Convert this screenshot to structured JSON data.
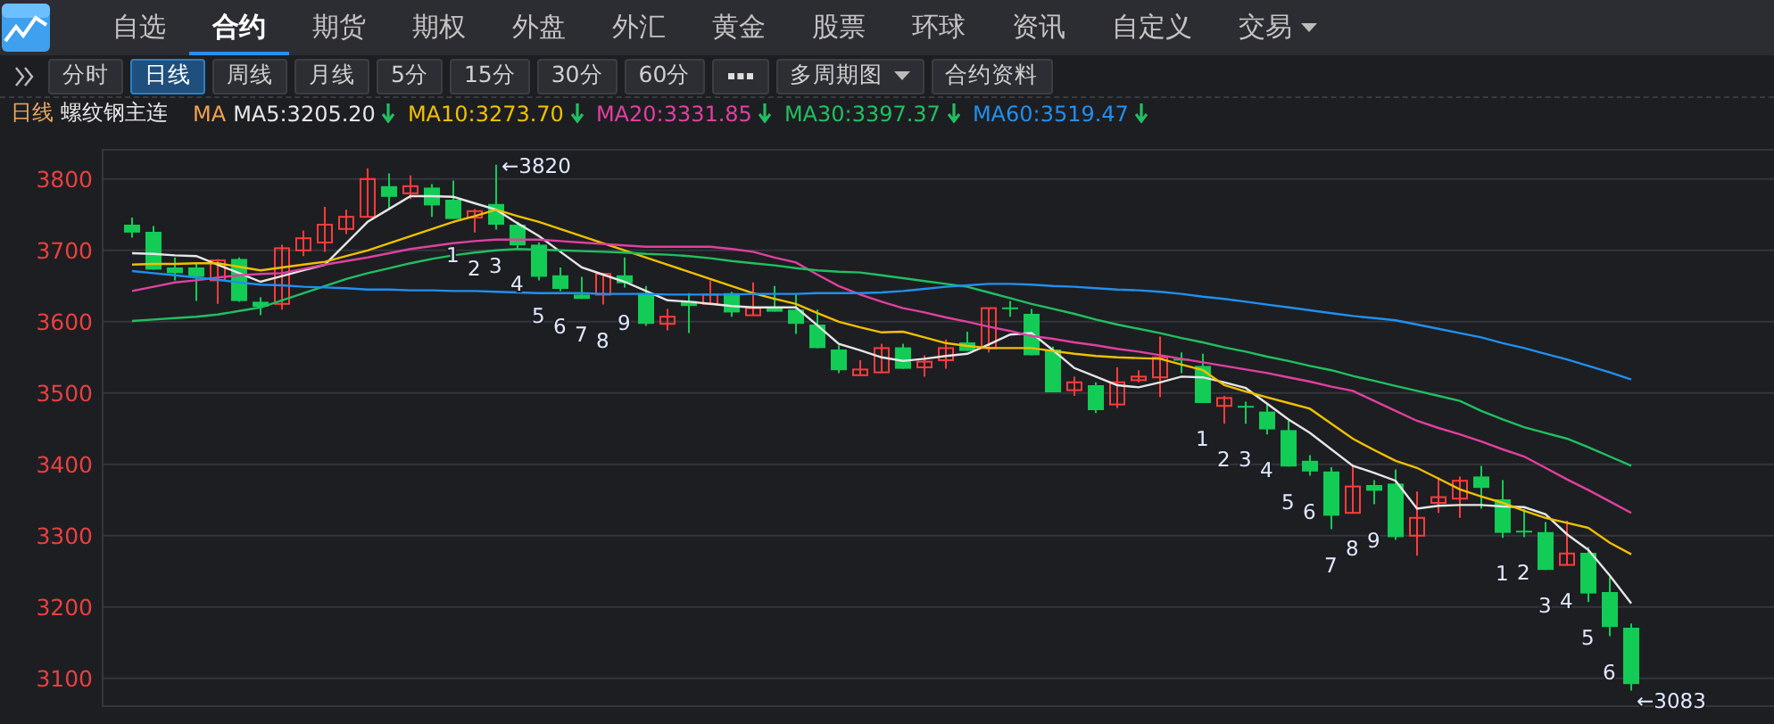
{
  "nav": {
    "tabs": [
      {
        "label": "自选",
        "selected": false,
        "dropdown": false
      },
      {
        "label": "合约",
        "selected": true,
        "dropdown": false
      },
      {
        "label": "期货",
        "selected": false,
        "dropdown": false
      },
      {
        "label": "期权",
        "selected": false,
        "dropdown": false
      },
      {
        "label": "外盘",
        "selected": false,
        "dropdown": false
      },
      {
        "label": "外汇",
        "selected": false,
        "dropdown": false
      },
      {
        "label": "黄金",
        "selected": false,
        "dropdown": false
      },
      {
        "label": "股票",
        "selected": false,
        "dropdown": false
      },
      {
        "label": "环球",
        "selected": false,
        "dropdown": false
      },
      {
        "label": "资讯",
        "selected": false,
        "dropdown": false
      },
      {
        "label": "自定义",
        "selected": false,
        "dropdown": false
      },
      {
        "label": "交易",
        "selected": false,
        "dropdown": true
      }
    ]
  },
  "toolbar": {
    "buttons": [
      {
        "kind": "text",
        "label": "分时",
        "selected": false
      },
      {
        "kind": "text",
        "label": "日线",
        "selected": true
      },
      {
        "kind": "text",
        "label": "周线",
        "selected": false
      },
      {
        "kind": "text",
        "label": "月线",
        "selected": false
      },
      {
        "kind": "text",
        "label": "5分",
        "selected": false
      },
      {
        "kind": "text",
        "label": "15分",
        "selected": false
      },
      {
        "kind": "text",
        "label": "30分",
        "selected": false
      },
      {
        "kind": "text",
        "label": "60分",
        "selected": false
      },
      {
        "kind": "more",
        "selected": false
      },
      {
        "kind": "dropdown",
        "label": "多周期图",
        "selected": false
      },
      {
        "kind": "text",
        "label": "合约资料",
        "selected": false
      }
    ]
  },
  "indicator_bar": {
    "period": "日线",
    "symbol": "螺纹钢主连",
    "label": "MA",
    "items": [
      {
        "text": "MA5:3205.20",
        "color": "#e6e6e6",
        "falling": true
      },
      {
        "text": "MA10:3273.70",
        "color": "#f0c000",
        "falling": true
      },
      {
        "text": "MA20:3331.85",
        "color": "#e040a0",
        "falling": true
      },
      {
        "text": "MA30:3397.37",
        "color": "#20c060",
        "falling": true
      },
      {
        "text": "MA60:3519.47",
        "color": "#2090f0",
        "falling": true
      }
    ]
  },
  "chart": {
    "chart_data": {
      "type": "candlestick",
      "grid": true,
      "ylim": [
        3061,
        3841
      ],
      "yticks": [
        3800,
        3700,
        3600,
        3500,
        3400,
        3300,
        3200,
        3100
      ],
      "ohlc": [
        [
          3736,
          3746,
          3718,
          3725
        ],
        [
          3726,
          3734,
          3673,
          3673
        ],
        [
          3676,
          3690,
          3658,
          3668
        ],
        [
          3676,
          3682,
          3629,
          3663
        ],
        [
          3658,
          3688,
          3625,
          3686
        ],
        [
          3688,
          3690,
          3628,
          3629
        ],
        [
          3628,
          3634,
          3609,
          3621
        ],
        [
          3625,
          3708,
          3617,
          3703
        ],
        [
          3700,
          3728,
          3692,
          3717
        ],
        [
          3711,
          3761,
          3698,
          3736
        ],
        [
          3730,
          3757,
          3723,
          3747
        ],
        [
          3747,
          3815,
          3747,
          3800
        ],
        [
          3790,
          3808,
          3757,
          3775
        ],
        [
          3780,
          3805,
          3772,
          3790
        ],
        [
          3788,
          3793,
          3747,
          3763
        ],
        [
          3771,
          3798,
          3744,
          3744
        ],
        [
          3746,
          3758,
          3725,
          3755
        ],
        [
          3765,
          3820,
          3729,
          3736
        ],
        [
          3736,
          3740,
          3703,
          3707
        ],
        [
          3708,
          3711,
          3658,
          3663
        ],
        [
          3665,
          3676,
          3643,
          3646
        ],
        [
          3638,
          3663,
          3632,
          3632
        ],
        [
          3638,
          3667,
          3624,
          3667
        ],
        [
          3665,
          3690,
          3648,
          3654
        ],
        [
          3640,
          3650,
          3594,
          3597
        ],
        [
          3597,
          3618,
          3588,
          3607
        ],
        [
          3629,
          3640,
          3584,
          3622
        ],
        [
          3625,
          3658,
          3625,
          3638
        ],
        [
          3640,
          3642,
          3607,
          3613
        ],
        [
          3609,
          3655,
          3609,
          3619
        ],
        [
          3621,
          3650,
          3614,
          3614
        ],
        [
          3617,
          3638,
          3583,
          3597
        ],
        [
          3596,
          3617,
          3563,
          3563
        ],
        [
          3561,
          3567,
          3528,
          3532
        ],
        [
          3525,
          3546,
          3525,
          3533
        ],
        [
          3529,
          3569,
          3528,
          3563
        ],
        [
          3564,
          3569,
          3534,
          3534
        ],
        [
          3536,
          3553,
          3523,
          3544
        ],
        [
          3546,
          3575,
          3534,
          3563
        ],
        [
          3571,
          3586,
          3559,
          3559
        ],
        [
          3563,
          3619,
          3557,
          3619
        ],
        [
          3620,
          3629,
          3607,
          3618
        ],
        [
          3611,
          3618,
          3553,
          3553
        ],
        [
          3561,
          3565,
          3501,
          3501
        ],
        [
          3504,
          3523,
          3496,
          3515
        ],
        [
          3511,
          3515,
          3472,
          3476
        ],
        [
          3484,
          3536,
          3479,
          3515
        ],
        [
          3518,
          3532,
          3515,
          3523
        ],
        [
          3522,
          3579,
          3494,
          3550
        ],
        [
          3548,
          3557,
          3528,
          3546
        ],
        [
          3538,
          3555,
          3486,
          3486
        ],
        [
          3482,
          3496,
          3457,
          3493
        ],
        [
          3482,
          3488,
          3457,
          3480
        ],
        [
          3474,
          3486,
          3442,
          3449
        ],
        [
          3448,
          3461,
          3397,
          3397
        ],
        [
          3405,
          3413,
          3384,
          3390
        ],
        [
          3390,
          3396,
          3309,
          3328
        ],
        [
          3332,
          3400,
          3332,
          3369
        ],
        [
          3371,
          3378,
          3344,
          3363
        ],
        [
          3373,
          3393,
          3294,
          3298
        ],
        [
          3300,
          3362,
          3272,
          3325
        ],
        [
          3346,
          3382,
          3332,
          3354
        ],
        [
          3352,
          3383,
          3325,
          3377
        ],
        [
          3383,
          3398,
          3338,
          3367
        ],
        [
          3351,
          3378,
          3297,
          3304
        ],
        [
          3307,
          3338,
          3298,
          3305
        ],
        [
          3305,
          3319,
          3252,
          3252
        ],
        [
          3259,
          3321,
          3259,
          3275
        ],
        [
          3276,
          3284,
          3207,
          3219
        ],
        [
          3221,
          3242,
          3159,
          3172
        ],
        [
          3171,
          3177,
          3083,
          3092
        ]
      ],
      "series": [
        {
          "type": "line",
          "color": "#e6e6e6",
          "values": [
            3696,
            3695,
            3693,
            3692,
            3680,
            3668,
            3656,
            3664,
            3672,
            3680,
            3710,
            3740,
            3758,
            3776,
            3776,
            3775,
            3766,
            3757,
            3738,
            3720,
            3698,
            3676,
            3666,
            3656,
            3643,
            3630,
            3628,
            3625,
            3622,
            3620,
            3620,
            3620,
            3595,
            3569,
            3560,
            3550,
            3545,
            3548,
            3552,
            3555,
            3568,
            3582,
            3584,
            3560,
            3535,
            3523,
            3511,
            3508,
            3515,
            3523,
            3522,
            3515,
            3507,
            3485,
            3463,
            3444,
            3421,
            3398,
            3388,
            3377,
            3338,
            3342,
            3343,
            3343,
            3341,
            3340,
            3330,
            3302,
            3280,
            3244,
            3205
          ]
        },
        {
          "type": "line",
          "color": "#f0c000",
          "values": [
            3680,
            3681,
            3681,
            3682,
            3682,
            3677,
            3672,
            3676,
            3680,
            3684,
            3692,
            3700,
            3710,
            3720,
            3730,
            3740,
            3748,
            3757,
            3748,
            3740,
            3730,
            3720,
            3710,
            3700,
            3690,
            3680,
            3670,
            3660,
            3650,
            3640,
            3632,
            3625,
            3612,
            3600,
            3592,
            3585,
            3586,
            3578,
            3570,
            3566,
            3563,
            3563,
            3563,
            3559,
            3555,
            3552,
            3550,
            3549,
            3548,
            3540,
            3532,
            3511,
            3502,
            3494,
            3486,
            3478,
            3457,
            3436,
            3420,
            3405,
            3395,
            3380,
            3365,
            3355,
            3346,
            3335,
            3325,
            3318,
            3311,
            3290,
            3274
          ]
        },
        {
          "type": "line",
          "color": "#e040a0",
          "values": [
            3643,
            3649,
            3655,
            3658,
            3662,
            3665,
            3667,
            3668,
            3674,
            3680,
            3685,
            3690,
            3696,
            3702,
            3706,
            3710,
            3713,
            3715,
            3715,
            3715,
            3713,
            3711,
            3709,
            3707,
            3705,
            3705,
            3705,
            3705,
            3702,
            3698,
            3690,
            3683,
            3666,
            3650,
            3638,
            3628,
            3619,
            3613,
            3606,
            3600,
            3593,
            3587,
            3580,
            3576,
            3571,
            3567,
            3562,
            3558,
            3553,
            3548,
            3543,
            3538,
            3533,
            3528,
            3522,
            3516,
            3509,
            3503,
            3489,
            3475,
            3461,
            3451,
            3442,
            3432,
            3421,
            3411,
            3395,
            3379,
            3364,
            3348,
            3332
          ]
        },
        {
          "type": "line",
          "color": "#20c060",
          "values": [
            3601,
            3603,
            3605,
            3607,
            3610,
            3615,
            3620,
            3630,
            3640,
            3650,
            3660,
            3668,
            3675,
            3682,
            3688,
            3693,
            3697,
            3700,
            3702,
            3701,
            3700,
            3699,
            3698,
            3697,
            3695,
            3694,
            3692,
            3689,
            3685,
            3682,
            3679,
            3675,
            3672,
            3670,
            3669,
            3665,
            3661,
            3657,
            3653,
            3649,
            3641,
            3633,
            3625,
            3618,
            3611,
            3603,
            3596,
            3590,
            3584,
            3577,
            3571,
            3564,
            3558,
            3551,
            3545,
            3538,
            3532,
            3524,
            3517,
            3510,
            3503,
            3496,
            3489,
            3475,
            3463,
            3452,
            3444,
            3436,
            3424,
            3411,
            3398
          ]
        },
        {
          "type": "line",
          "color": "#2090f0",
          "values": [
            3671,
            3668,
            3665,
            3662,
            3659,
            3655,
            3652,
            3651,
            3649,
            3648,
            3647,
            3645,
            3645,
            3644,
            3644,
            3643,
            3643,
            3642,
            3641,
            3640,
            3640,
            3640,
            3639,
            3639,
            3639,
            3638,
            3638,
            3638,
            3638,
            3639,
            3639,
            3639,
            3640,
            3640,
            3640,
            3641,
            3643,
            3646,
            3649,
            3651,
            3653,
            3653,
            3652,
            3650,
            3649,
            3647,
            3645,
            3644,
            3642,
            3639,
            3635,
            3632,
            3628,
            3624,
            3620,
            3616,
            3612,
            3608,
            3605,
            3602,
            3596,
            3590,
            3584,
            3578,
            3570,
            3563,
            3555,
            3547,
            3538,
            3529,
            3519
          ]
        }
      ],
      "annotations": [
        "←3820",
        "←3083",
        "1",
        "2",
        "3",
        "4",
        "5",
        "6",
        "7",
        "8",
        "9",
        "1",
        "2",
        "3",
        "4",
        "5",
        "6",
        "7",
        "8",
        "9",
        "1",
        "2",
        "3",
        "4",
        "5",
        "6"
      ]
    }
  }
}
